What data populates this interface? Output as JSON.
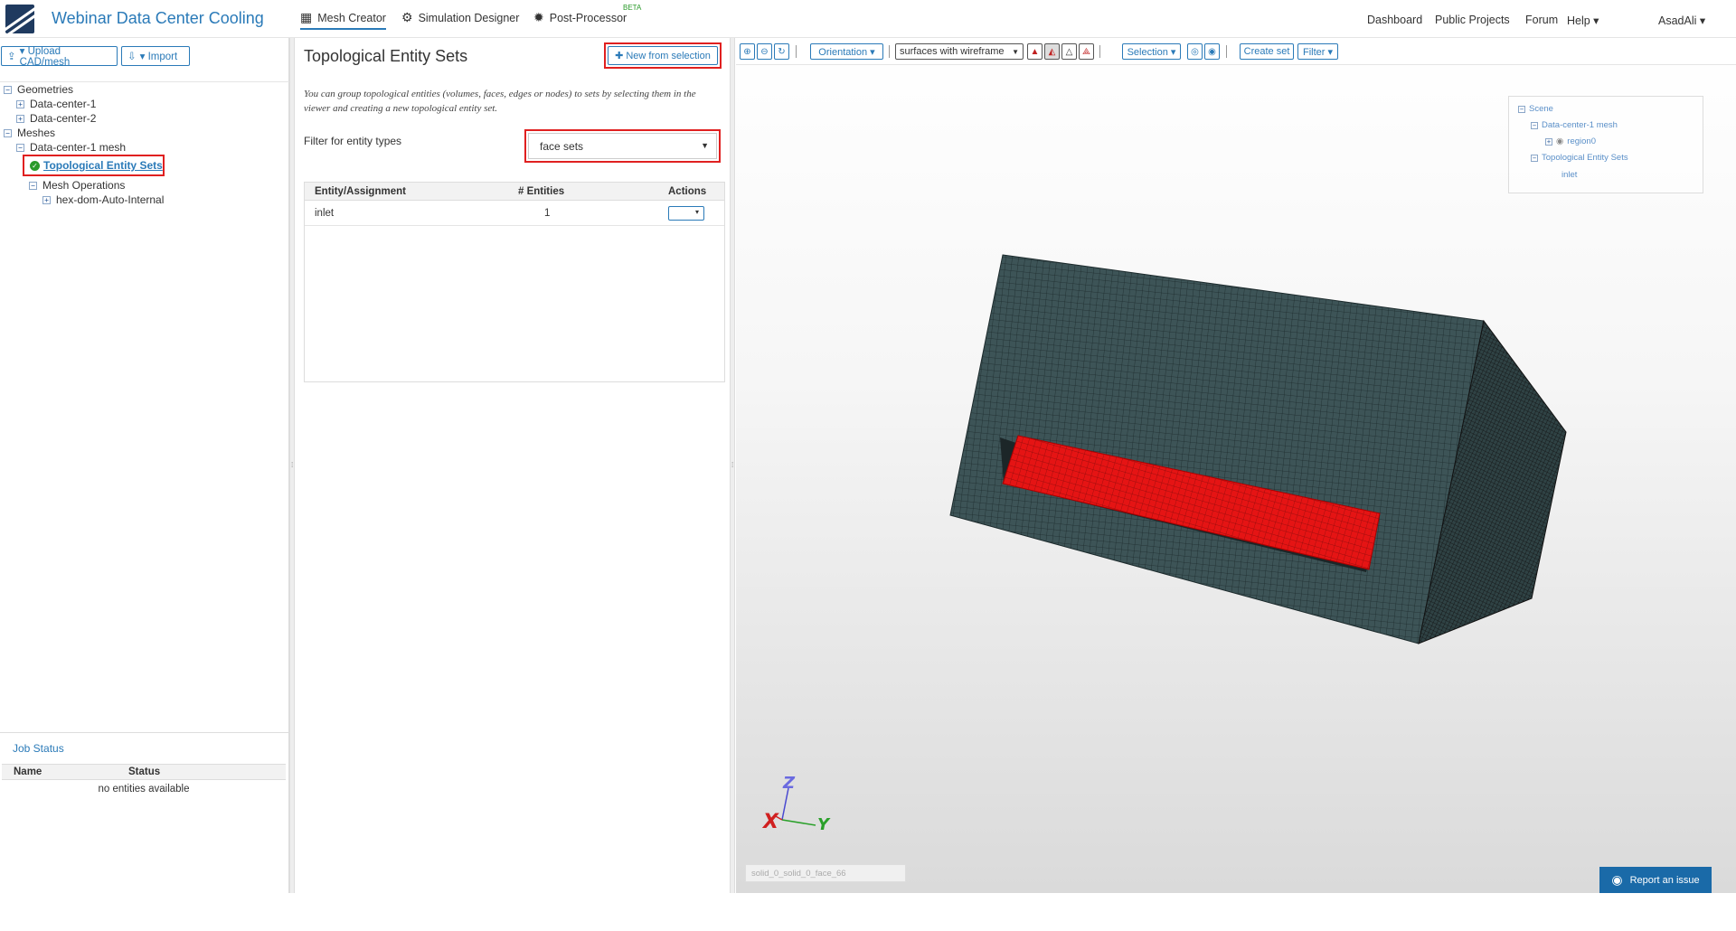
{
  "header": {
    "app_title": "Webinar Data Center Cooling",
    "tabs": [
      {
        "label": "Mesh Creator",
        "icon": "grid-icon"
      },
      {
        "label": "Simulation Designer",
        "icon": "gears-icon"
      },
      {
        "label": "Post-Processor",
        "icon": "gear-icon"
      }
    ],
    "beta": "BETA",
    "links": [
      "Dashboard",
      "Public Projects",
      "Forum",
      "Help ▾"
    ],
    "user": "AsadAli ▾"
  },
  "left": {
    "upload_label": "▾ Upload CAD/mesh",
    "import_label": "▾ Import",
    "tree": {
      "geometries": "Geometries",
      "geo1": "Data-center-1",
      "geo2": "Data-center-2",
      "meshes": "Meshes",
      "mesh1": "Data-center-1 mesh",
      "tes": "Topological Entity Sets",
      "mesh_ops": "Mesh Operations",
      "op1": "hex-dom-Auto-Internal"
    },
    "job_status": {
      "title": "Job Status",
      "col_name": "Name",
      "col_status": "Status",
      "empty": "no entities available"
    }
  },
  "middle": {
    "title": "Topological Entity Sets",
    "new_from_selection": "New from selection",
    "hint": "You can group topological entities (volumes, faces, edges or nodes) to sets by selecting them in the viewer and creating a new topological entity set.",
    "filter_label": "Filter for entity types",
    "filter_value": "face sets",
    "table": {
      "col_entity": "Entity/Assignment",
      "col_count": "# Entities",
      "col_actions": "Actions",
      "rows": [
        {
          "name": "inlet",
          "count": "1"
        }
      ]
    }
  },
  "viewer": {
    "orientation": "Orientation ▾",
    "render_mode": "surfaces with wireframe",
    "selection": "Selection ▾",
    "create_set": "Create set",
    "filter": "Filter ▾",
    "scene": {
      "root": "Scene",
      "mesh": "Data-center-1 mesh",
      "region": "region0",
      "tes": "Topological Entity Sets",
      "inlet": "inlet"
    },
    "axes": {
      "x": "X",
      "y": "Y",
      "z": "Z"
    },
    "status_text": "solid_0_solid_0_face_66",
    "report": "Report an issue"
  },
  "colors": {
    "accent": "#2a7ab8",
    "highlight": "#e02020",
    "mesh": "#3d5457",
    "selected_face": "#e51414"
  }
}
